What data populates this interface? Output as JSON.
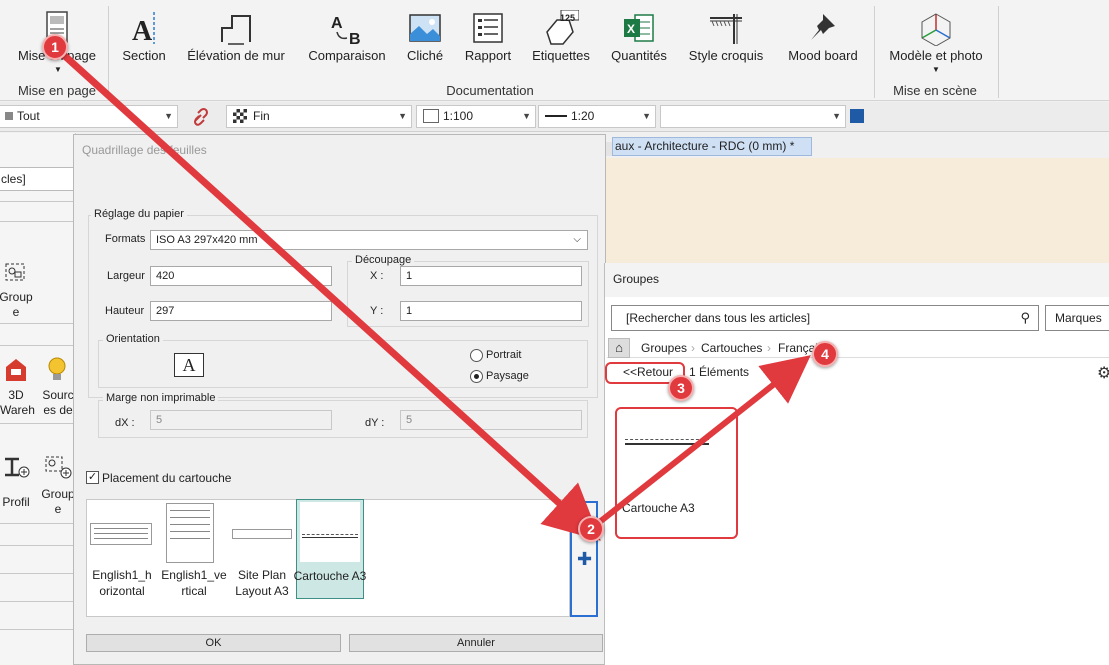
{
  "ribbon": {
    "buttons": [
      {
        "label": "Mise en page",
        "icon": "page-layout-icon"
      },
      {
        "label": "Section",
        "icon": "section-icon"
      },
      {
        "label": "Élévation de mur",
        "icon": "wall-elevation-icon"
      },
      {
        "label": "Comparaison",
        "icon": "compare-ab-icon"
      },
      {
        "label": "Cliché",
        "icon": "snapshot-icon"
      },
      {
        "label": "Rapport",
        "icon": "report-icon"
      },
      {
        "label": "Etiquettes",
        "icon": "label-tag-icon",
        "badge": "125"
      },
      {
        "label": "Quantités",
        "icon": "excel-icon"
      },
      {
        "label": "Style croquis",
        "icon": "sketch-style-icon"
      },
      {
        "label": "Mood board",
        "icon": "pin-icon"
      },
      {
        "label": "Modèle et photo",
        "icon": "model-photo-icon"
      }
    ],
    "groups": {
      "mise_en_page": "Mise en page",
      "documentation": "Documentation",
      "mise_en_scene": "Mise en scène"
    }
  },
  "toolbar": {
    "tout": "Tout",
    "fin": "Fin",
    "scale1": "1:100",
    "scale2": "1:20",
    "empty_combo": ""
  },
  "leftpanel": {
    "search_frag": "cles]",
    "items": [
      "Group e",
      "3D Wareh",
      "Sourc es de",
      "Profil",
      "Group e"
    ]
  },
  "dialog": {
    "title": "Quadrillage des feuilles",
    "reglage_legend": "Réglage du papier",
    "formats_label": "Formats",
    "formats_value": "ISO A3 297x420 mm",
    "largeur_label": "Largeur",
    "largeur_value": "420",
    "hauteur_label": "Hauteur",
    "hauteur_value": "297",
    "decoupage_legend": "Découpage",
    "x_label": "X :",
    "x_value": "1",
    "y_label": "Y :",
    "y_value": "1",
    "orientation_legend": "Orientation",
    "portrait": "Portrait",
    "paysage": "Paysage",
    "marge_legend": "Marge non imprimable",
    "dx_label": "dX :",
    "dx_value": "5",
    "dy_label": "dY :",
    "dy_value": "5",
    "placement_label": "Placement du cartouche",
    "thumbs": [
      {
        "label": "English1_h orizontal"
      },
      {
        "label": "English1_ve rtical"
      },
      {
        "label": "Site Plan Layout A3"
      },
      {
        "label": "Cartouche A3"
      }
    ],
    "ok": "OK",
    "annuler": "Annuler"
  },
  "canvas": {
    "tab": "aux - Architecture - RDC (0 mm) *"
  },
  "groupes": {
    "title": "Groupes",
    "search_placeholder": "[Rechercher dans tous les articles]",
    "marques": "Marques",
    "crumbs": [
      "Groupes",
      "Cartouches",
      "Français"
    ],
    "retour": "<<Retour",
    "count": "1 Éléments",
    "item": "Cartouche A3"
  },
  "annotations": [
    "1",
    "2",
    "3",
    "4"
  ],
  "colors": {
    "accent_red": "#e0393e",
    "select_teal": "#cde8e4",
    "add_blue": "#1f5aa6"
  }
}
